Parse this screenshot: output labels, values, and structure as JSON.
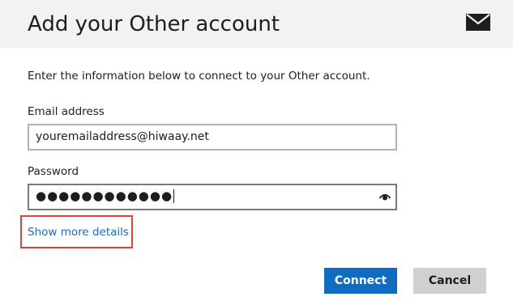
{
  "dialog": {
    "title": "Add your Other account",
    "header_icon": "mail-icon",
    "intro_text": "Enter the information below to connect to your Other account."
  },
  "form": {
    "email_label": "Email address",
    "email_value": "youremailaddress@hiwaay.net",
    "password_label": "Password",
    "password_value": "●●●●●●●●●●●●",
    "password_reveal_icon": "eye-icon",
    "more_details_link": "Show more details"
  },
  "buttons": {
    "connect_label": "Connect",
    "cancel_label": "Cancel"
  },
  "colors": {
    "header_bg": "#f2f2f2",
    "link": "#1f6bb6",
    "primary_button": "#0f6cc0",
    "secondary_button": "#d0d0d0",
    "highlight_border": "#d9453b"
  }
}
